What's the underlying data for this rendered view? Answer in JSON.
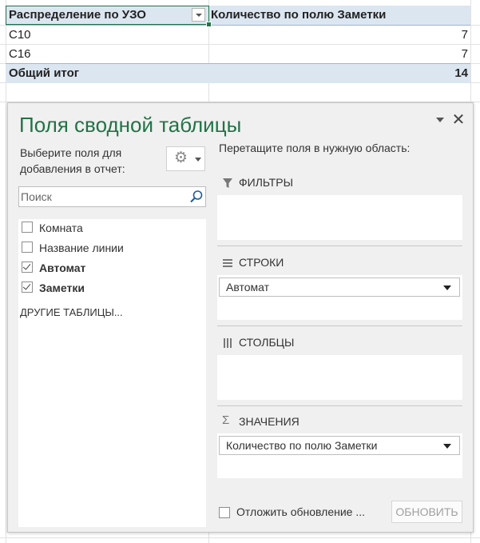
{
  "pivot_table": {
    "header": {
      "row_label": "Распределение по УЗО",
      "value_label": "Количество по полю Заметки"
    },
    "rows": [
      {
        "label": "С10",
        "value": "7"
      },
      {
        "label": "С16",
        "value": "7"
      }
    ],
    "total": {
      "label": "Общий итог",
      "value": "14"
    }
  },
  "pane": {
    "title": "Поля сводной таблицы",
    "choose_fields_label": "Выберите поля для добавления в отчет:",
    "search_placeholder": "Поиск",
    "fields": [
      {
        "label": "Комната",
        "checked": false
      },
      {
        "label": "Название линии",
        "checked": false
      },
      {
        "label": "Автомат",
        "checked": true
      },
      {
        "label": "Заметки",
        "checked": true
      }
    ],
    "other_tables": "ДРУГИЕ ТАБЛИЦЫ...",
    "drag_label": "Перетащите поля в нужную область:",
    "areas": {
      "filters": {
        "title": "ФИЛЬТРЫ",
        "items": []
      },
      "rows": {
        "title": "СТРОКИ",
        "items": [
          "Автомат"
        ]
      },
      "columns": {
        "title": "СТОЛБЦЫ",
        "items": []
      },
      "values": {
        "title": "ЗНАЧЕНИЯ",
        "items": [
          "Количество по полю Заметки"
        ]
      }
    },
    "defer_label": "Отложить обновление ...",
    "update_button": "ОБНОВИТЬ"
  },
  "colors": {
    "accent": "#217346",
    "header_fill": "#dce6f1",
    "pane_bg": "#f0f0f0"
  },
  "icons": [
    "dropdown-filter-icon",
    "chevron-down-icon",
    "close-icon",
    "gear-icon",
    "search-icon",
    "filter-funnel-icon",
    "rows-icon",
    "columns-icon",
    "sigma-icon"
  ]
}
